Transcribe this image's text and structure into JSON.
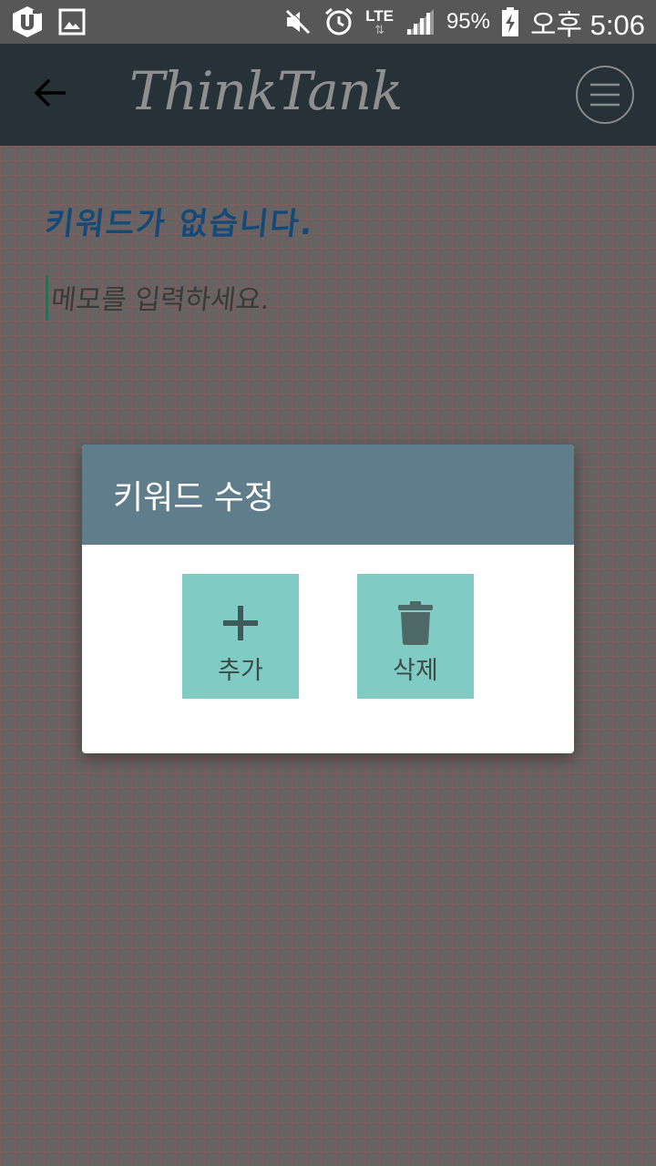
{
  "status_bar": {
    "battery_percent": "95%",
    "network": "LTE",
    "time": "오후 5:06",
    "icons": [
      "u-plus-icon",
      "gallery-icon",
      "mute-icon",
      "alarm-icon",
      "lte-icon",
      "signal-icon",
      "battery-charging-icon"
    ]
  },
  "app_bar": {
    "title": "ThinkTank",
    "back_icon": "back-arrow-icon",
    "menu_icon": "menu-icon"
  },
  "content": {
    "keyword_heading": "키워드가 없습니다.",
    "memo_placeholder": "메모를 입력하세요."
  },
  "dialog": {
    "title": "키워드 수정",
    "buttons": [
      {
        "label": "추가",
        "icon": "plus-icon"
      },
      {
        "label": "삭제",
        "icon": "trash-icon"
      }
    ]
  },
  "colors": {
    "status_bar": "#575757",
    "app_bar": "#263238",
    "dialog_header": "#607d8b",
    "action_button": "#80cbc4",
    "keyword_text": "#154a78"
  }
}
